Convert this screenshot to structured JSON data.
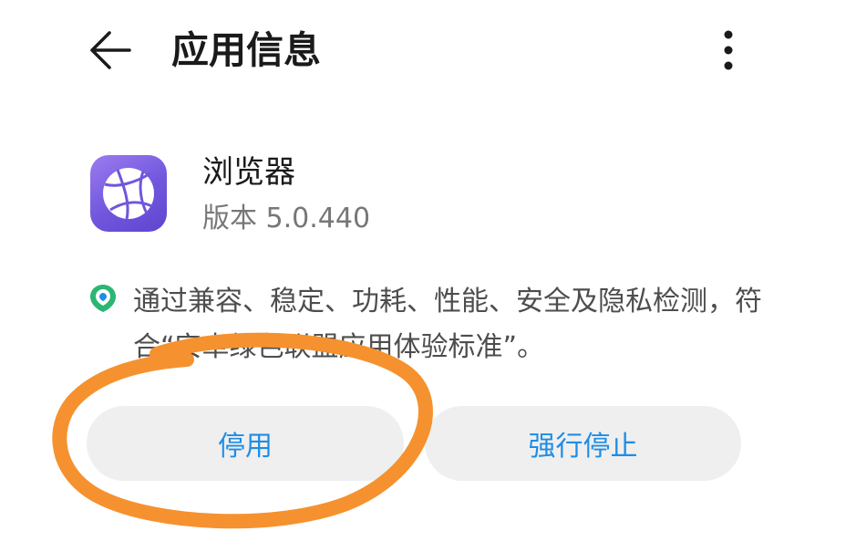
{
  "header": {
    "title": "应用信息",
    "back_icon": "back-arrow-icon",
    "more_icon": "more-vertical-icon"
  },
  "app": {
    "name": "浏览器",
    "version": "版本 5.0.440",
    "icon": "browser-globe-icon",
    "icon_color": "#7156dd"
  },
  "certification": {
    "icon": "shield-check-icon",
    "text": "通过兼容、稳定、功耗、性能、安全及隐私检测，符合“安卓绿色联盟应用体验标准”。"
  },
  "actions": {
    "disable_label": "停用",
    "force_stop_label": "强行停止",
    "accent_color": "#1e8de6"
  },
  "annotation": {
    "color": "#f5922f"
  }
}
